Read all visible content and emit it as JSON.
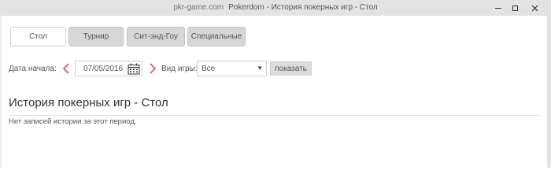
{
  "window": {
    "site": "pkr-game.com",
    "title": "Pokerdom - История покерных игр - Стол"
  },
  "tabs": [
    {
      "label": "Стол",
      "active": true
    },
    {
      "label": "Турнир",
      "active": false
    },
    {
      "label": "Сит-энд-Гоу",
      "active": false
    },
    {
      "label": "Специальные",
      "active": false
    }
  ],
  "filters": {
    "start_date_label": "Дата начала:",
    "start_date_value": "07/05/2016",
    "game_type_label": "Вид игры:",
    "game_type_value": "Все",
    "show_button": "показать"
  },
  "history": {
    "title": "История покерных игр - Стол",
    "empty_message": "Нет записей истории за этот период."
  },
  "colors": {
    "titlebar_bg": "#e3e3e3",
    "tab_bg": "#d7d7d7",
    "arrow_red": "#d9534f",
    "button_bg": "#dcdcdc"
  },
  "icons": [
    "minimize-icon",
    "maximize-icon",
    "close-icon",
    "chevron-left-icon",
    "chevron-right-icon",
    "calendar-icon",
    "caret-down-icon"
  ]
}
